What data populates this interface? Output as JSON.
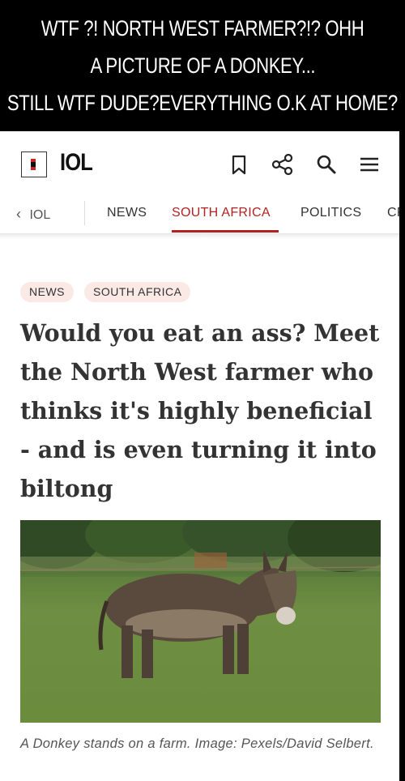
{
  "meme": {
    "lines": [
      "WTF ?! NORTH WEST FARMER?!? OHH",
      "A PICTURE OF A DONKEY...",
      "STILL WTF DUDE?EVERYTHING O.K AT HOME?"
    ]
  },
  "header": {
    "logo_text": "IOL",
    "icons": [
      "bookmark-icon",
      "share-icon",
      "search-icon",
      "menu-icon"
    ]
  },
  "nav": {
    "back_label": "IOL",
    "items": [
      "NEWS",
      "SOUTH AFRICA",
      "POLITICS",
      "CR"
    ],
    "active_item": "SOUTH AFRICA",
    "accent_color": "#b22222"
  },
  "article": {
    "tags": [
      "NEWS",
      "SOUTH AFRICA"
    ],
    "headline": "Would you eat an ass? Meet the North West farmer who thinks it's highly beneficial - and is even turning it into biltong",
    "image_caption": "A Donkey stands on a farm. Image: Pexels/David Selbert."
  }
}
